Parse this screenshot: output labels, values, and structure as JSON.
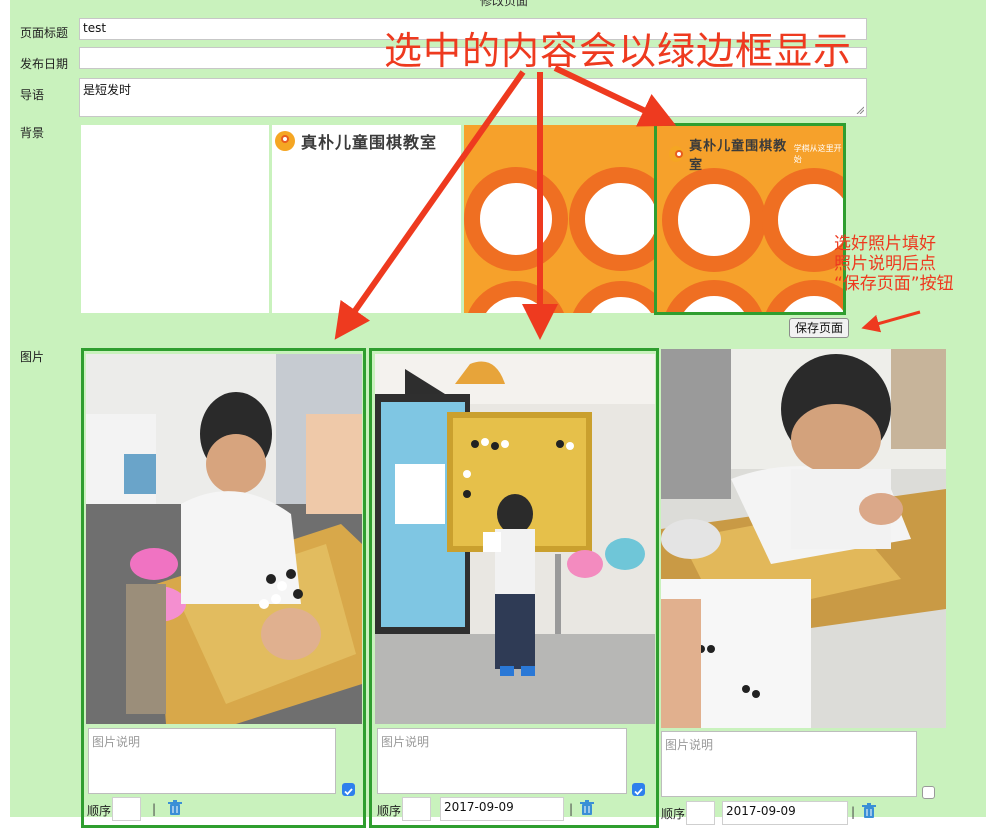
{
  "page": {
    "title": "修改页面"
  },
  "form": {
    "title_label": "页面标题",
    "title_value": "test",
    "date_label": "发布日期",
    "date_value": "",
    "intro_label": "导语",
    "intro_value": "是短发时",
    "background_label": "背景",
    "photos_label": "图片",
    "save_button": "保存页面"
  },
  "backgrounds": [
    {
      "kind": "blank",
      "selected": false
    },
    {
      "kind": "logo",
      "logo_text": "真朴儿童围棋教室",
      "selected": false
    },
    {
      "kind": "orange-rings",
      "selected": false
    },
    {
      "kind": "orange-rings-logo",
      "logo_text": "真朴儿童围棋教室",
      "tagline": "学棋从这里开始",
      "selected": true
    }
  ],
  "photos": [
    {
      "caption_placeholder": "图片说明",
      "caption_value": "",
      "checked": true,
      "order_label": "顺序",
      "order_value": "",
      "date_value": "",
      "separator": "|",
      "delete_icon": "trash-icon",
      "selected": true
    },
    {
      "caption_placeholder": "图片说明",
      "caption_value": "",
      "checked": true,
      "order_label": "顺序",
      "order_value": "",
      "date_value": "2017-09-09",
      "separator": "|",
      "delete_icon": "trash-icon",
      "selected": true
    },
    {
      "caption_placeholder": "图片说明",
      "caption_value": "",
      "checked": false,
      "order_label": "顺序",
      "order_value": "",
      "date_value": "2017-09-09",
      "separator": "|",
      "delete_icon": "trash-icon",
      "selected": false
    }
  ],
  "annotations": {
    "main": "选中的内容会以绿边框显示",
    "side": "选好照片填好\n照片说明后点\n“保存页面”按钮"
  },
  "colors": {
    "panel": "#c9f2bd",
    "selected_border": "#2f9e2f",
    "annotation": "#ee3a1f",
    "orange": "#f6a12b",
    "ring": "#ef6f22",
    "checkbox": "#2f80ed"
  }
}
